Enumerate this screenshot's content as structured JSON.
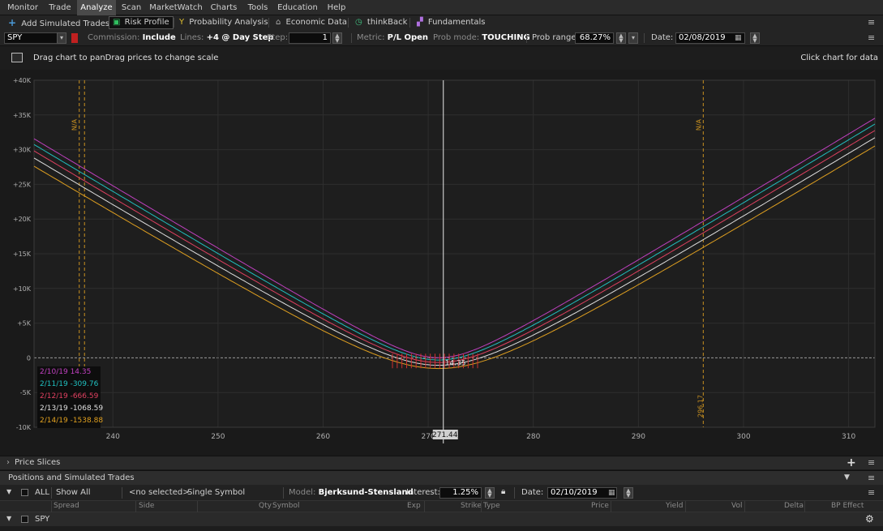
{
  "menu": [
    "Monitor",
    "Trade",
    "Analyze",
    "Scan",
    "MarketWatch",
    "Charts",
    "Tools",
    "Education",
    "Help"
  ],
  "menu_active": "Analyze",
  "toolbar": {
    "add_trades": "Add Simulated Trades",
    "risk_profile": "Risk Profile",
    "prob_analysis": "Probability Analysis",
    "economic": "Economic Data",
    "thinkback": "thinkBack",
    "fundamentals": "Fundamentals"
  },
  "params": {
    "symbol": "SPY",
    "commission_label": "Commission:",
    "commission_value": "Include",
    "lines_label": "Lines:",
    "lines_value": "+4 @ Day Step",
    "step_label": "Step:",
    "step_value": "1",
    "metric_label": "Metric:",
    "metric_value": "P/L Open",
    "prob_mode_label": "Prob mode:",
    "prob_mode_value": "TOUCHING",
    "prob_range_label": "Prob range:",
    "prob_range_value": "68.27%",
    "date_label": "Date:",
    "date_value": "02/08/2019"
  },
  "chart_header": {
    "hint": "Drag chart to panDrag prices to change scale",
    "click_hint": "Click chart for data"
  },
  "chart_data": {
    "type": "line",
    "y_ticks": [
      "+40K",
      "+35K",
      "+30K",
      "+25K",
      "+20K",
      "+15K",
      "+10K",
      "+5K",
      "0",
      "-5K",
      "-10K"
    ],
    "y_values": [
      40000,
      35000,
      30000,
      25000,
      20000,
      15000,
      10000,
      5000,
      0,
      -5000,
      -10000
    ],
    "ylim": [
      -10000,
      40000
    ],
    "x_ticks": [
      "240",
      "250",
      "260",
      "270",
      "280",
      "290",
      "300",
      "310"
    ],
    "x_values": [
      240,
      250,
      260,
      270,
      280,
      290,
      300,
      310
    ],
    "xlim": [
      232.5,
      312.5
    ],
    "vlines": [
      {
        "x": 236.8,
        "label": "N/A",
        "color": "#c89020"
      },
      {
        "x": 237.3,
        "label": "",
        "color": "#c89020"
      },
      {
        "x": 296.17,
        "label": "N/A",
        "color": "#c89020"
      }
    ],
    "vline_bottom_label": "296.17",
    "cursor_x": 271.44,
    "cursor_label": "271.44",
    "center_value_label": "14.35",
    "strike": 271,
    "series": [
      {
        "name": "2/10/19",
        "value": "14.35",
        "min": 14.35,
        "color": "#c040c0"
      },
      {
        "name": "2/11/19",
        "value": "-309.76",
        "min": -309.76,
        "color": "#20c0c0"
      },
      {
        "name": "2/12/19",
        "value": "-666.59",
        "min": -666.59,
        "color": "#e04060"
      },
      {
        "name": "2/13/19",
        "value": "-1068.59",
        "min": -1068.59,
        "color": "#e0e0e0"
      },
      {
        "name": "2/14/19",
        "value": "-1538.88",
        "min": -1538.88,
        "color": "#e0a020"
      }
    ],
    "grid": true
  },
  "price_slices": "Price Slices",
  "positions_title": "Positions and Simulated Trades",
  "filter": {
    "all": "ALL",
    "show": "Show All",
    "selected": "<no selected>",
    "single": "Single Symbol",
    "model_label": "Model:",
    "model_value": "Bjerksund-Stensland",
    "interest_label": "Interest:",
    "interest_value": "1.25%",
    "date_label": "Date:",
    "date_value": "02/10/2019"
  },
  "columns": [
    "Spread",
    "Side",
    "Qty",
    "Symbol",
    "Exp",
    "Strike",
    "Type",
    "Price",
    "Yield",
    "Vol",
    "Delta",
    "BP Effect"
  ],
  "position_symbol": "SPY"
}
